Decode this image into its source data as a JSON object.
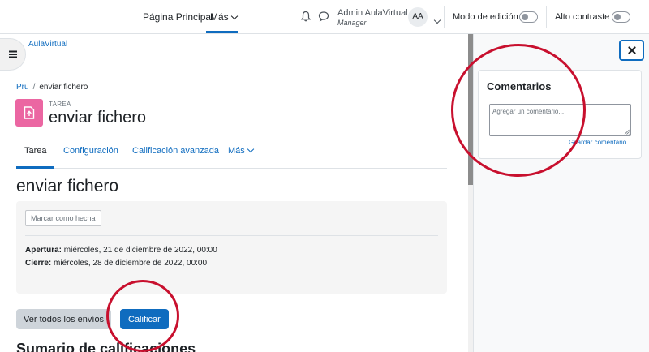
{
  "topnav": {
    "home_label": "Página Principal",
    "more_label": "Más",
    "user_name": "Admin AulaVirtual",
    "user_role": "Manager",
    "avatar_initials": "AA",
    "edit_mode_label": "Modo de edición",
    "high_contrast_label": "Alto contraste"
  },
  "site": {
    "name": "AulaVirtual"
  },
  "breadcrumb": {
    "course": "Pru",
    "current": "enviar fichero"
  },
  "activity": {
    "type": "TAREA",
    "title": "enviar fichero",
    "icon_color": "#eb66a2"
  },
  "secondary_nav": {
    "tabs": [
      {
        "label": "Tarea"
      },
      {
        "label": "Configuración"
      },
      {
        "label": "Calificación avanzada"
      },
      {
        "label": "Más"
      }
    ]
  },
  "main": {
    "heading": "enviar fichero",
    "mark_done_label": "Marcar como hecha",
    "opening_label": "Apertura:",
    "opening_value": "miércoles, 21 de diciembre de 2022, 00:00",
    "closing_label": "Cierre:",
    "closing_value": "miércoles, 28 de diciembre de 2022, 00:00",
    "view_all_label": "Ver todos los envíos",
    "grade_label": "Calificar",
    "section_heading_partial": "Sumario de calificaciones"
  },
  "drawer": {
    "comments_title": "Comentarios",
    "comment_placeholder": "Agregar un comentario...",
    "save_comment_label": "Guardar comentario"
  },
  "colors": {
    "primary": "#0f6cbf",
    "annotation": "#c8102e"
  }
}
